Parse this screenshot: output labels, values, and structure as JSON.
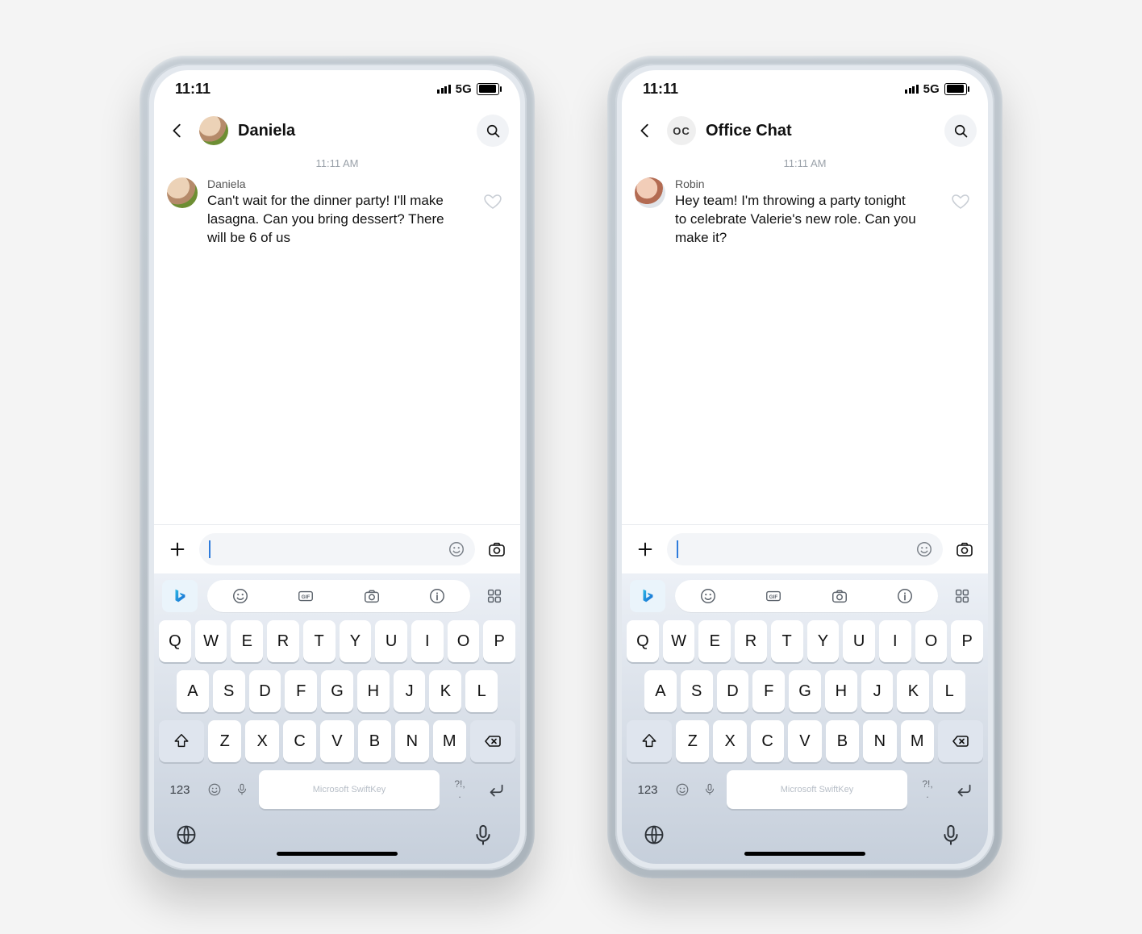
{
  "status": {
    "time": "11:11",
    "network": "5G"
  },
  "keyboard": {
    "brand": "Microsoft SwiftKey",
    "rows": [
      [
        "Q",
        "W",
        "E",
        "R",
        "T",
        "Y",
        "U",
        "I",
        "O",
        "P"
      ],
      [
        "A",
        "S",
        "D",
        "F",
        "G",
        "H",
        "J",
        "K",
        "L"
      ],
      [
        "Z",
        "X",
        "C",
        "V",
        "B",
        "N",
        "M"
      ]
    ],
    "numkey": "123",
    "punct_top": "?!,",
    "punct_bot": "."
  },
  "phones": [
    {
      "chat_title": "Daniela",
      "avatar_kind": "daniela",
      "avatar_text": "",
      "timestamp": "11:11 AM",
      "message": {
        "sender": "Daniela",
        "text": "Can't wait for the dinner party! I'll make lasagna. Can you bring dessert? There will be 6 of us",
        "avatar_kind": "daniela"
      }
    },
    {
      "chat_title": "Office Chat",
      "avatar_kind": "oc",
      "avatar_text": "OC",
      "timestamp": "11:11 AM",
      "message": {
        "sender": "Robin",
        "text": "Hey team! I'm throwing a party tonight to celebrate Valerie's new role. Can you make it?",
        "avatar_kind": "robin"
      }
    }
  ]
}
